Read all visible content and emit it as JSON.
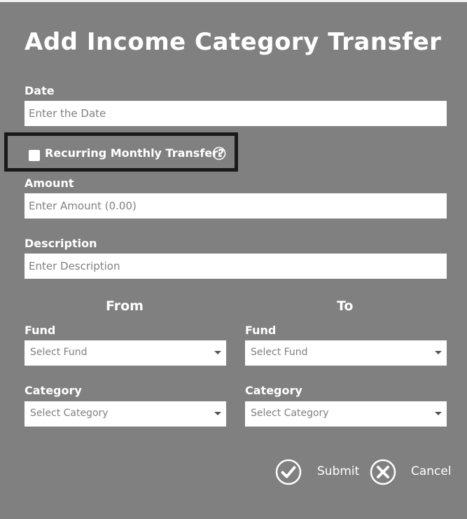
{
  "dialog": {
    "title": "Add Income Category Transfer"
  },
  "date": {
    "label": "Date",
    "placeholder": "Enter the Date",
    "value": ""
  },
  "recurring": {
    "label": "Recurring Monthly Transfer?",
    "checked": false,
    "info_icon": "info-icon"
  },
  "amount": {
    "label": "Amount",
    "placeholder": "Enter Amount (0.00)",
    "value": ""
  },
  "description": {
    "label": "Description",
    "placeholder": "Enter Description",
    "value": ""
  },
  "from": {
    "heading": "From",
    "fund": {
      "label": "Fund",
      "selected": "Select Fund"
    },
    "category": {
      "label": "Category",
      "selected": "Select Category"
    }
  },
  "to": {
    "heading": "To",
    "fund": {
      "label": "Fund",
      "selected": "Select Fund"
    },
    "category": {
      "label": "Category",
      "selected": "Select Category"
    }
  },
  "actions": {
    "submit_label": "Submit",
    "submit_icon": "check-circle-icon",
    "cancel_label": "Cancel",
    "cancel_icon": "x-circle-icon"
  },
  "colors": {
    "background": "#808080",
    "text": "#ffffff",
    "highlight_border": "#1a1a1a"
  }
}
